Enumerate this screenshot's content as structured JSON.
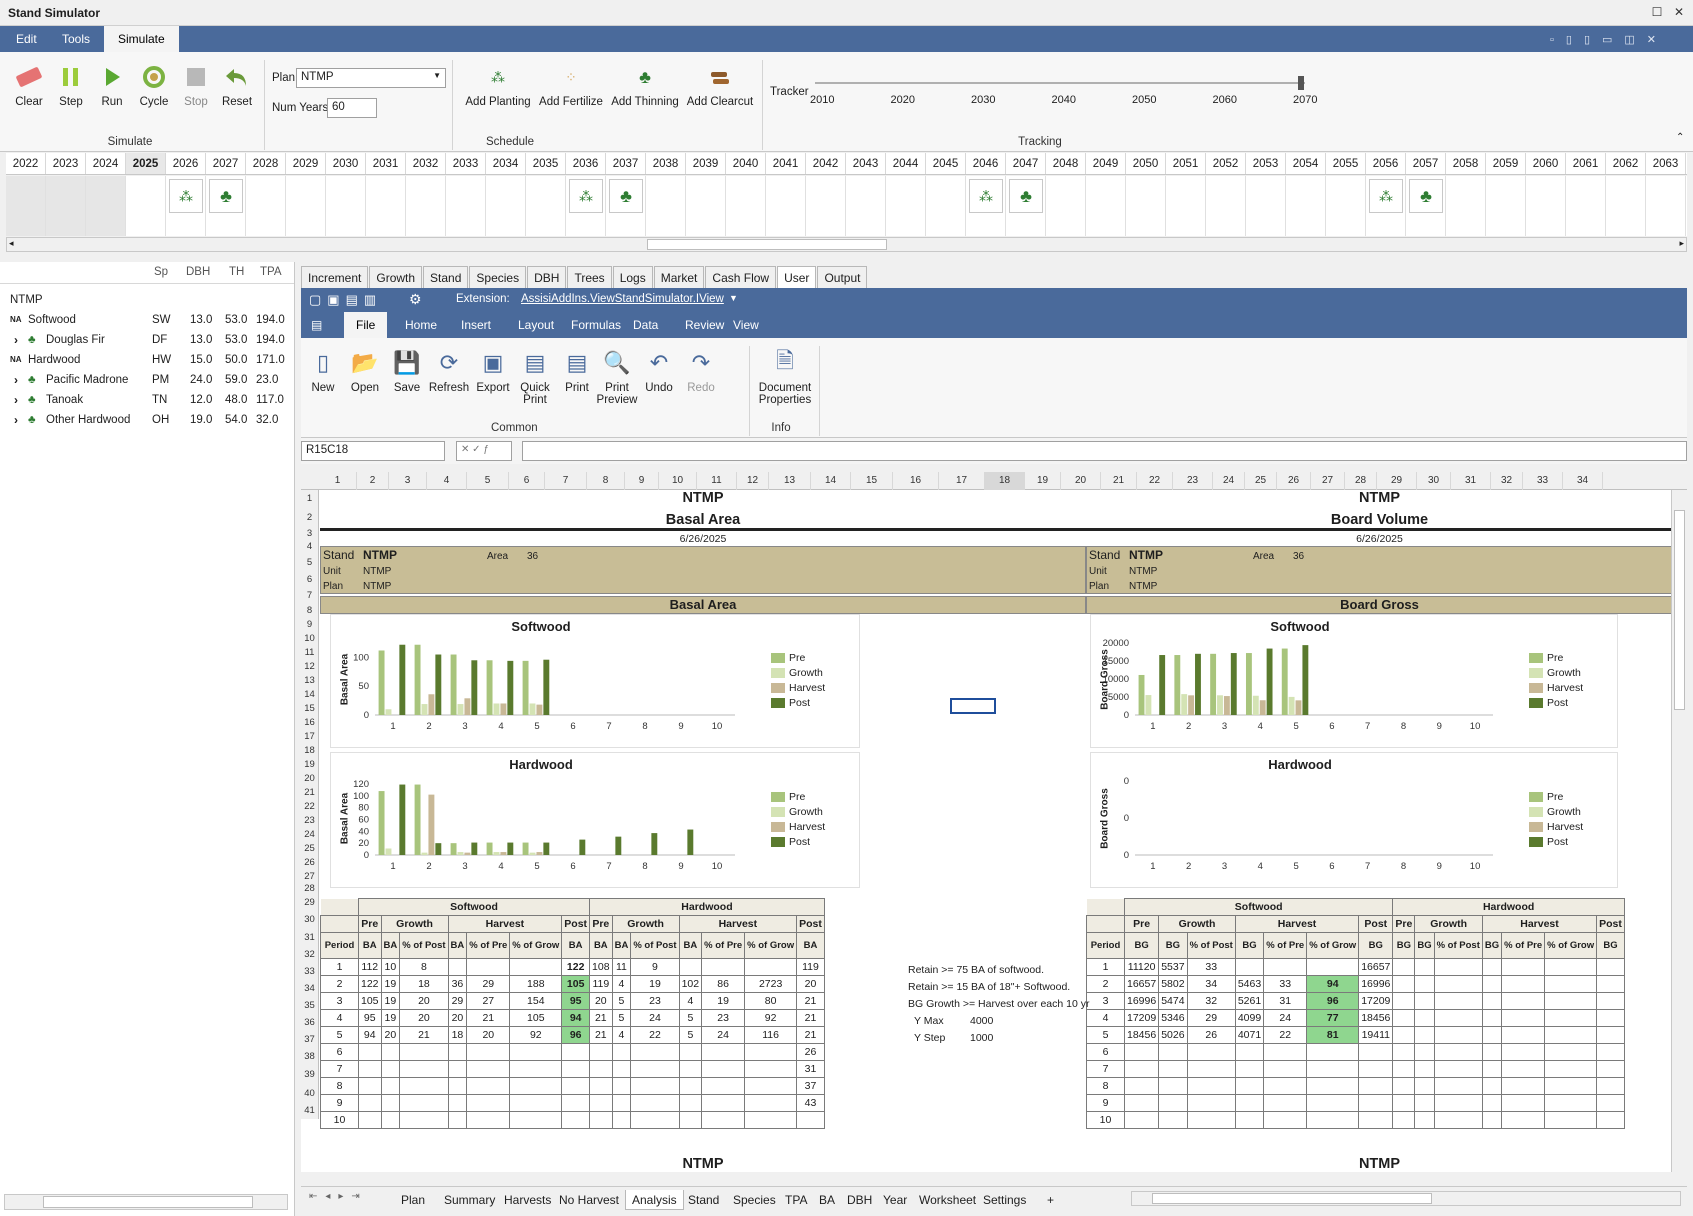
{
  "app": {
    "title": "Stand Simulator"
  },
  "menu": [
    "Edit",
    "Tools",
    "Simulate"
  ],
  "ribbon": {
    "simulate": {
      "group": "Simulate",
      "buttons": [
        "Clear",
        "Step",
        "Run",
        "Cycle",
        "Stop",
        "Reset"
      ]
    },
    "schedule": {
      "group": "Schedule",
      "plan_label": "Plan",
      "plan_value": "NTMP",
      "numyears_label": "Num Years",
      "numyears_value": "60",
      "buttons": [
        "Add Planting",
        "Add Fertilize",
        "Add Thinning",
        "Add Clearcut"
      ]
    },
    "tracking": {
      "group": "Tracking",
      "label": "Tracker",
      "ticks": [
        "2010",
        "2020",
        "2030",
        "2040",
        "2050",
        "2060",
        "2070"
      ]
    }
  },
  "years": [
    "2022",
    "2023",
    "2024",
    "2025",
    "2026",
    "2027",
    "2028",
    "2029",
    "2030",
    "2031",
    "2032",
    "2033",
    "2034",
    "2035",
    "2036",
    "2037",
    "2038",
    "2039",
    "2040",
    "2041",
    "2042",
    "2043",
    "2044",
    "2045",
    "2046",
    "2047",
    "2048",
    "2049",
    "2050",
    "2051",
    "2052",
    "2053",
    "2054",
    "2055",
    "2056",
    "2057",
    "2058",
    "2059",
    "2060",
    "2061",
    "2062",
    "2063"
  ],
  "selected_year": "2025",
  "left": {
    "headers": [
      "Sp",
      "DBH",
      "TH",
      "TPA"
    ],
    "root": "NTMP",
    "rows": [
      {
        "name": "Softwood",
        "prefix": "NA",
        "sp": "SW",
        "dbh": "13.0",
        "th": "53.0",
        "tpa": "194.0"
      },
      {
        "name": "Douglas Fir",
        "prefix": "›",
        "sp": "DF",
        "dbh": "13.0",
        "th": "53.0",
        "tpa": "194.0"
      },
      {
        "name": "Hardwood",
        "prefix": "NA",
        "sp": "HW",
        "dbh": "15.0",
        "th": "50.0",
        "tpa": "171.0"
      },
      {
        "name": "Pacific Madrone",
        "prefix": "›",
        "sp": "PM",
        "dbh": "24.0",
        "th": "59.0",
        "tpa": "23.0"
      },
      {
        "name": "Tanoak",
        "prefix": "›",
        "sp": "TN",
        "dbh": "12.0",
        "th": "48.0",
        "tpa": "117.0"
      },
      {
        "name": "Other Hardwood",
        "prefix": "›",
        "sp": "OH",
        "dbh": "19.0",
        "th": "54.0",
        "tpa": "32.0"
      }
    ]
  },
  "tabs": [
    "Increment",
    "Growth",
    "Stand",
    "Species",
    "DBH",
    "Trees",
    "Logs",
    "Market",
    "Cash Flow",
    "User",
    "Output"
  ],
  "qat": {
    "extension_label": "Extension:",
    "extension_value": "AssisiAddIns.ViewStandSimulator.IView"
  },
  "ss_menu": [
    "File",
    "Home",
    "Insert",
    "Layout",
    "Formulas",
    "Data",
    "Review",
    "View"
  ],
  "ss_ribbon": {
    "common": [
      "New",
      "Open",
      "Save",
      "Refresh",
      "Export",
      "Quick Print",
      "Print",
      "Print Preview",
      "Undo",
      "Redo"
    ],
    "common_label": "Common",
    "info": [
      "Document Properties"
    ],
    "info_label": "Info"
  },
  "formula": {
    "cellref": "R15C18"
  },
  "colnums": [
    "1",
    "2",
    "3",
    "4",
    "5",
    "6",
    "7",
    "8",
    "9",
    "10",
    "11",
    "12",
    "13",
    "14",
    "15",
    "16",
    "17",
    "18",
    "19",
    "20",
    "21",
    "22",
    "23",
    "24",
    "25",
    "26",
    "27",
    "28",
    "29",
    "30",
    "31",
    "32",
    "33",
    "34"
  ],
  "left_sheet": {
    "title": "NTMP",
    "subtitle": "Basal Area",
    "date": "6/26/2025",
    "stand_label": "Stand",
    "stand": "NTMP",
    "area_label": "Area",
    "area": "36",
    "unit_label": "Unit",
    "unit": "NTMP",
    "plan_label": "Plan",
    "plan": "NTMP",
    "band": "Basal Area"
  },
  "right_sheet": {
    "title": "NTMP",
    "subtitle": "Board Volume",
    "date": "6/26/2025",
    "stand_label": "Stand",
    "stand": "NTMP",
    "area_label": "Area",
    "area": "36",
    "unit_label": "Unit",
    "unit": "NTMP",
    "plan_label": "Plan",
    "plan": "NTMP",
    "band": "Board Gross"
  },
  "chart_data": [
    {
      "type": "bar",
      "title": "Softwood",
      "ylabel": "Basal Area",
      "categories": [
        "1",
        "2",
        "3",
        "4",
        "5",
        "6",
        "7",
        "8",
        "9",
        "10"
      ],
      "ylim": [
        0,
        125
      ],
      "yticks": [
        "0",
        "50",
        "100"
      ],
      "series": [
        {
          "name": "Pre",
          "values": [
            112,
            122,
            105,
            95,
            94,
            0,
            0,
            0,
            0,
            0
          ]
        },
        {
          "name": "Growth",
          "values": [
            10,
            19,
            19,
            20,
            20,
            0,
            0,
            0,
            0,
            0
          ]
        },
        {
          "name": "Harvest",
          "values": [
            0,
            36,
            29,
            20,
            18,
            0,
            0,
            0,
            0,
            0
          ]
        },
        {
          "name": "Post",
          "values": [
            122,
            105,
            95,
            94,
            96,
            0,
            0,
            0,
            0,
            0
          ]
        }
      ]
    },
    {
      "type": "bar",
      "title": "Hardwood",
      "ylabel": "Basal Area",
      "categories": [
        "1",
        "2",
        "3",
        "4",
        "5",
        "6",
        "7",
        "8",
        "9",
        "10"
      ],
      "ylim": [
        0,
        125
      ],
      "yticks": [
        "0",
        "20",
        "40",
        "60",
        "80",
        "100",
        "120"
      ],
      "series": [
        {
          "name": "Pre",
          "values": [
            108,
            119,
            20,
            21,
            21,
            0,
            0,
            0,
            0,
            0
          ]
        },
        {
          "name": "Growth",
          "values": [
            11,
            4,
            5,
            5,
            4,
            0,
            0,
            0,
            0,
            0
          ]
        },
        {
          "name": "Harvest",
          "values": [
            0,
            102,
            4,
            5,
            5,
            0,
            0,
            0,
            0,
            0
          ]
        },
        {
          "name": "Post",
          "values": [
            119,
            20,
            21,
            21,
            21,
            26,
            31,
            37,
            43,
            0
          ]
        }
      ]
    },
    {
      "type": "bar",
      "title": "Softwood",
      "ylabel": "Board Gross",
      "categories": [
        "1",
        "2",
        "3",
        "4",
        "5",
        "6",
        "7",
        "8",
        "9",
        "10"
      ],
      "ylim": [
        0,
        20000
      ],
      "yticks": [
        "0",
        "5000",
        "10000",
        "15000",
        "20000"
      ],
      "series": [
        {
          "name": "Pre",
          "values": [
            11120,
            16657,
            16996,
            17209,
            18456,
            0,
            0,
            0,
            0,
            0
          ]
        },
        {
          "name": "Growth",
          "values": [
            5537,
            5802,
            5474,
            5346,
            5026,
            0,
            0,
            0,
            0,
            0
          ]
        },
        {
          "name": "Harvest",
          "values": [
            0,
            5463,
            5261,
            4099,
            4071,
            0,
            0,
            0,
            0,
            0
          ]
        },
        {
          "name": "Post",
          "values": [
            16657,
            16996,
            17209,
            18456,
            19411,
            0,
            0,
            0,
            0,
            0
          ]
        }
      ]
    },
    {
      "type": "bar",
      "title": "Hardwood",
      "ylabel": "Board Gross",
      "categories": [
        "1",
        "2",
        "3",
        "4",
        "5",
        "6",
        "7",
        "8",
        "9",
        "10"
      ],
      "yticks": [
        "0",
        "0",
        "0"
      ],
      "series": [
        {
          "name": "Pre",
          "values": [
            0,
            0,
            0,
            0,
            0,
            0,
            0,
            0,
            0,
            0
          ]
        },
        {
          "name": "Growth",
          "values": [
            0,
            0,
            0,
            0,
            0,
            0,
            0,
            0,
            0,
            0
          ]
        },
        {
          "name": "Harvest",
          "values": [
            0,
            0,
            0,
            0,
            0,
            0,
            0,
            0,
            0,
            0
          ]
        },
        {
          "name": "Post",
          "values": [
            0,
            0,
            0,
            0,
            0,
            0,
            0,
            0,
            0,
            0
          ]
        }
      ]
    }
  ],
  "legend": [
    "Pre",
    "Growth",
    "Harvest",
    "Post"
  ],
  "colors": {
    "pre": "#a8c47c",
    "growth": "#d4e3b4",
    "harvest": "#c8b896",
    "post": "#5a7a2e"
  },
  "ba_table": {
    "group_softwood": "Softwood",
    "group_hardwood": "Hardwood",
    "h1": [
      "Pre",
      "Growth",
      "Harvest",
      "Post"
    ],
    "h2": [
      "Period",
      "BA",
      "BA",
      "% of Post",
      "BA",
      "% of Pre",
      "% of Grow",
      "BA"
    ],
    "rows": [
      [
        "1",
        "112",
        "10",
        "8",
        "",
        "",
        "",
        "122",
        "108",
        "11",
        "9",
        "",
        "",
        "",
        "119"
      ],
      [
        "2",
        "122",
        "19",
        "18",
        "36",
        "29",
        "188",
        "105",
        "119",
        "4",
        "19",
        "102",
        "86",
        "2723",
        "20"
      ],
      [
        "3",
        "105",
        "19",
        "20",
        "29",
        "27",
        "154",
        "95",
        "20",
        "5",
        "23",
        "4",
        "19",
        "80",
        "21"
      ],
      [
        "4",
        "95",
        "19",
        "20",
        "20",
        "21",
        "105",
        "94",
        "21",
        "5",
        "24",
        "5",
        "23",
        "92",
        "21"
      ],
      [
        "5",
        "94",
        "20",
        "21",
        "18",
        "20",
        "92",
        "96",
        "21",
        "4",
        "22",
        "5",
        "24",
        "116",
        "21"
      ],
      [
        "6",
        "",
        "",
        "",
        "",
        "",
        "",
        "",
        "",
        "",
        "",
        "",
        "",
        "",
        "26"
      ],
      [
        "7",
        "",
        "",
        "",
        "",
        "",
        "",
        "",
        "",
        "",
        "",
        "",
        "",
        "",
        "31"
      ],
      [
        "8",
        "",
        "",
        "",
        "",
        "",
        "",
        "",
        "",
        "",
        "",
        "",
        "",
        "",
        "37"
      ],
      [
        "9",
        "",
        "",
        "",
        "",
        "",
        "",
        "",
        "",
        "",
        "",
        "",
        "",
        "",
        "43"
      ],
      [
        "10",
        "",
        "",
        "",
        "",
        "",
        "",
        "",
        "",
        "",
        "",
        "",
        "",
        "",
        ""
      ]
    ]
  },
  "bg_table": {
    "h2": [
      "Period",
      "BG",
      "BG",
      "% of Post",
      "BG",
      "% of Pre",
      "% of Grow",
      "BG"
    ],
    "rows": [
      [
        "1",
        "11120",
        "5537",
        "33",
        "",
        "",
        "",
        "16657"
      ],
      [
        "2",
        "16657",
        "5802",
        "34",
        "5463",
        "33",
        "94",
        "16996"
      ],
      [
        "3",
        "16996",
        "5474",
        "32",
        "5261",
        "31",
        "96",
        "17209"
      ],
      [
        "4",
        "17209",
        "5346",
        "29",
        "4099",
        "24",
        "77",
        "18456"
      ],
      [
        "5",
        "18456",
        "5026",
        "26",
        "4071",
        "22",
        "81",
        "19411"
      ],
      [
        "6",
        "",
        "",
        "",
        "",
        "",
        "",
        ""
      ],
      [
        "7",
        "",
        "",
        "",
        "",
        "",
        "",
        ""
      ],
      [
        "8",
        "",
        "",
        "",
        "",
        "",
        "",
        ""
      ],
      [
        "9",
        "",
        "",
        "",
        "",
        "",
        "",
        ""
      ],
      [
        "10",
        "",
        "",
        "",
        "",
        "",
        "",
        ""
      ]
    ]
  },
  "notes": [
    "Retain >= 75 BA of softwood.",
    "Retain >= 15 BA of 18\"+ Softwood.",
    "BG Growth >= Harvest over each 10 yr"
  ],
  "ymax_label": "Y Max",
  "ymax": "4000",
  "ystep_label": "Y Step",
  "ystep": "1000",
  "bottom_title": "NTMP",
  "sheets": [
    "Plan",
    "Summary",
    "Harvests",
    "No Harvest",
    "Analysis",
    "Stand",
    "Species",
    "TPA",
    "BA",
    "DBH",
    "Year",
    "Worksheet",
    "Settings",
    "+"
  ],
  "selected_sheet": "Analysis"
}
